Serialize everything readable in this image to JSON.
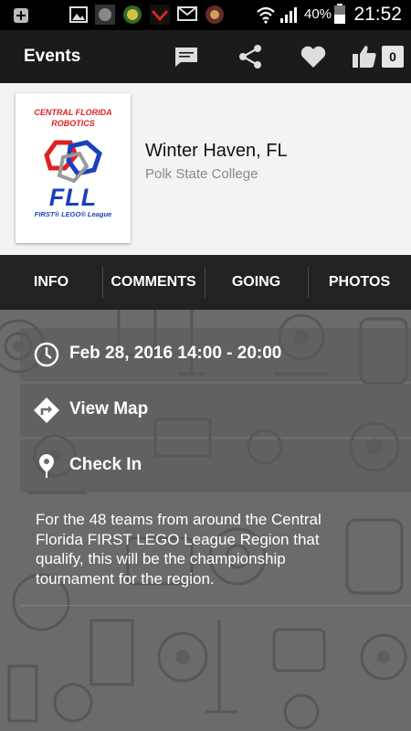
{
  "statusbar": {
    "battery_percent": "40%",
    "clock": "21:52",
    "icons": [
      "add-icon",
      "gallery-icon",
      "app-icon",
      "app-icon",
      "app-icon",
      "mail-icon",
      "app-icon",
      "wifi-icon",
      "signal-icon",
      "battery-icon"
    ]
  },
  "actionbar": {
    "title": "Events",
    "likes_count": "0",
    "icons": [
      "comment-icon",
      "share-icon",
      "heart-icon",
      "thumbs-up-icon"
    ]
  },
  "event": {
    "title": "Winter Haven, FL",
    "venue": "Polk State College",
    "logo": {
      "line1": "CENTRAL FLORIDA",
      "line2": "ROBOTICS",
      "mark": "FLL",
      "subtitle": "FIRST® LEGO® League"
    }
  },
  "tabs": [
    "INFO",
    "COMMENTS",
    "GOING",
    "PHOTOS"
  ],
  "details": {
    "date": "Feb 28, 2016 14:00 - 20:00",
    "map_label": "View Map",
    "checkin_label": "Check In",
    "description": "For the 48 teams from around the Central Florida FIRST LEGO League Region that qualify, this will be the championship tournament for the region."
  },
  "colors": {
    "status_bar": "#000000",
    "action_bar": "#1b1b1b",
    "tabs_bar": "#222222",
    "header_bg": "#f3f3f3",
    "content_bg": "#6b6b6b",
    "logo_red": "#e02020",
    "logo_blue": "#1a3fc0"
  }
}
